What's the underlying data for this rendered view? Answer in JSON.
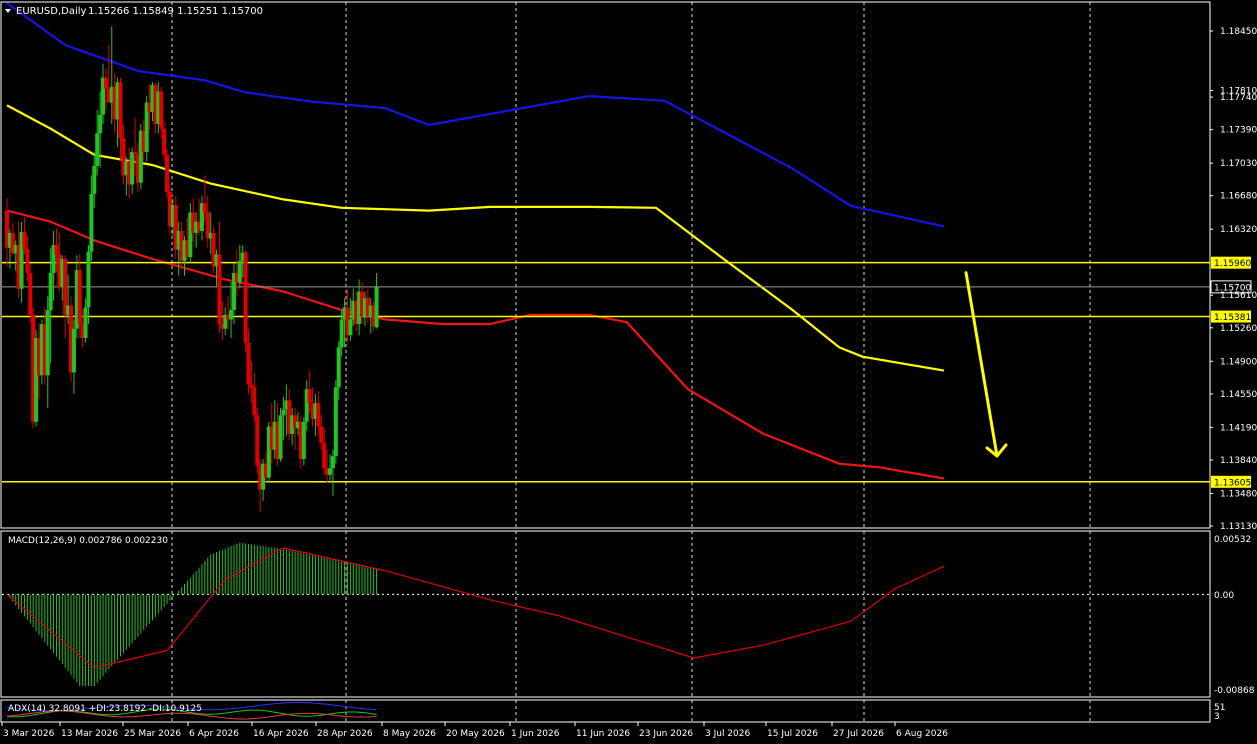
{
  "header": {
    "symbol": "EURUSD,Daily",
    "ohlc": "1.15266 1.15849 1.15251 1.15700"
  },
  "macd_panel": {
    "label": "MACD(12,26,9) 0.002786 0.002230",
    "tick_labels": [
      "0.00532",
      "0.00",
      "-0.00868"
    ]
  },
  "adx_panel": {
    "label": "ADX(14) 32.8091 +DI:23.8192 -DI:10.9125",
    "tick_labels": [
      "51",
      "3"
    ]
  },
  "colors": {
    "bull": "#22c322",
    "bear": "#e00000",
    "ma_blue": "#1414e6",
    "ma_yellow": "#ffff00",
    "ma_red": "#f01414",
    "level": "#ffff00",
    "current_price": "#ffffff",
    "grid": "#ffffff",
    "macd_hist": "#22c322",
    "macd_signal": "#e00000"
  },
  "chart_data": {
    "type": "candlestick",
    "x_tick_labels": [
      "3 Mar 2026",
      "13 Mar 2026",
      "25 Mar 2026",
      "6 Apr 2026",
      "16 Apr 2026",
      "28 Apr 2026",
      "8 May 2026",
      "20 May 2026",
      "1 Jun 2026",
      "11 Jun 2026",
      "23 Jun 2026",
      "3 Jul 2026",
      "15 Jul 2026",
      "27 Jul 2026",
      "6 Aug 2026"
    ],
    "y_tick_labels": [
      1.1845,
      1.1781,
      1.1774,
      1.1739,
      1.1703,
      1.1668,
      1.1632,
      1.1561,
      1.1526,
      1.149,
      1.1455,
      1.1419,
      1.1384,
      1.1348,
      1.1313
    ],
    "ylim": [
      1.1313,
      1.1865
    ],
    "grid": true,
    "horizontal_levels": [
      1.1596,
      1.15381,
      1.13605
    ],
    "current_price": 1.157,
    "last_candle": {
      "open": 1.15266,
      "high": 1.15849,
      "low": 1.15251,
      "close": 1.157
    },
    "annotation": "yellow arrow pointing down from 1.1596 toward 1.1384",
    "candles": [
      {
        "o": 1.1652,
        "h": 1.1665,
        "l": 1.1592,
        "c": 1.1612
      },
      {
        "o": 1.1612,
        "h": 1.1632,
        "l": 1.159,
        "c": 1.1628
      },
      {
        "o": 1.1628,
        "h": 1.1639,
        "l": 1.1604,
        "c": 1.1606
      },
      {
        "o": 1.1606,
        "h": 1.162,
        "l": 1.1587,
        "c": 1.1615
      },
      {
        "o": 1.1615,
        "h": 1.164,
        "l": 1.1558,
        "c": 1.1568
      },
      {
        "o": 1.1568,
        "h": 1.164,
        "l": 1.1553,
        "c": 1.1629
      },
      {
        "o": 1.1629,
        "h": 1.1645,
        "l": 1.1605,
        "c": 1.1611
      },
      {
        "o": 1.1611,
        "h": 1.1625,
        "l": 1.1576,
        "c": 1.1585
      },
      {
        "o": 1.1585,
        "h": 1.1595,
        "l": 1.1531,
        "c": 1.154
      },
      {
        "o": 1.154,
        "h": 1.1548,
        "l": 1.1418,
        "c": 1.1425
      },
      {
        "o": 1.1425,
        "h": 1.1524,
        "l": 1.142,
        "c": 1.1515
      },
      {
        "o": 1.1515,
        "h": 1.1531,
        "l": 1.145,
        "c": 1.1475
      },
      {
        "o": 1.1475,
        "h": 1.1535,
        "l": 1.1465,
        "c": 1.153
      },
      {
        "o": 1.153,
        "h": 1.1548,
        "l": 1.1465,
        "c": 1.1475
      },
      {
        "o": 1.1475,
        "h": 1.156,
        "l": 1.144,
        "c": 1.1545
      },
      {
        "o": 1.1545,
        "h": 1.1612,
        "l": 1.1488,
        "c": 1.1585
      },
      {
        "o": 1.1585,
        "h": 1.163,
        "l": 1.1555,
        "c": 1.1615
      },
      {
        "o": 1.1615,
        "h": 1.1633,
        "l": 1.1585,
        "c": 1.1605
      },
      {
        "o": 1.1605,
        "h": 1.1628,
        "l": 1.1565,
        "c": 1.157
      },
      {
        "o": 1.157,
        "h": 1.1604,
        "l": 1.1555,
        "c": 1.16
      },
      {
        "o": 1.16,
        "h": 1.1604,
        "l": 1.1515,
        "c": 1.154
      },
      {
        "o": 1.154,
        "h": 1.1583,
        "l": 1.153,
        "c": 1.155
      },
      {
        "o": 1.155,
        "h": 1.156,
        "l": 1.1468,
        "c": 1.1478
      },
      {
        "o": 1.1478,
        "h": 1.1535,
        "l": 1.1455,
        "c": 1.1525
      },
      {
        "o": 1.1525,
        "h": 1.1604,
        "l": 1.1515,
        "c": 1.1588
      },
      {
        "o": 1.1588,
        "h": 1.1605,
        "l": 1.1515,
        "c": 1.153
      },
      {
        "o": 1.153,
        "h": 1.1545,
        "l": 1.1505,
        "c": 1.1515
      },
      {
        "o": 1.1515,
        "h": 1.1558,
        "l": 1.151,
        "c": 1.1548
      },
      {
        "o": 1.1548,
        "h": 1.1615,
        "l": 1.153,
        "c": 1.1608
      },
      {
        "o": 1.1608,
        "h": 1.169,
        "l": 1.1598,
        "c": 1.167
      },
      {
        "o": 1.167,
        "h": 1.1715,
        "l": 1.1655,
        "c": 1.17
      },
      {
        "o": 1.17,
        "h": 1.176,
        "l": 1.169,
        "c": 1.1735
      },
      {
        "o": 1.1735,
        "h": 1.178,
        "l": 1.1698,
        "c": 1.1755
      },
      {
        "o": 1.1755,
        "h": 1.181,
        "l": 1.1745,
        "c": 1.1795
      },
      {
        "o": 1.1795,
        "h": 1.1805,
        "l": 1.176,
        "c": 1.1783
      },
      {
        "o": 1.1783,
        "h": 1.183,
        "l": 1.177,
        "c": 1.1768
      },
      {
        "o": 1.1768,
        "h": 1.185,
        "l": 1.1745,
        "c": 1.1785
      },
      {
        "o": 1.1785,
        "h": 1.18,
        "l": 1.1735,
        "c": 1.175
      },
      {
        "o": 1.175,
        "h": 1.1795,
        "l": 1.172,
        "c": 1.179
      },
      {
        "o": 1.179,
        "h": 1.1795,
        "l": 1.1705,
        "c": 1.173
      },
      {
        "o": 1.173,
        "h": 1.1745,
        "l": 1.168,
        "c": 1.169
      },
      {
        "o": 1.169,
        "h": 1.171,
        "l": 1.1668,
        "c": 1.1705
      },
      {
        "o": 1.1705,
        "h": 1.172,
        "l": 1.1665,
        "c": 1.168
      },
      {
        "o": 1.168,
        "h": 1.172,
        "l": 1.167,
        "c": 1.1715
      },
      {
        "o": 1.1715,
        "h": 1.1752,
        "l": 1.169,
        "c": 1.1712
      },
      {
        "o": 1.1712,
        "h": 1.1725,
        "l": 1.1672,
        "c": 1.1682
      },
      {
        "o": 1.1682,
        "h": 1.1745,
        "l": 1.1675,
        "c": 1.1738
      },
      {
        "o": 1.1738,
        "h": 1.175,
        "l": 1.1705,
        "c": 1.1715
      },
      {
        "o": 1.1715,
        "h": 1.1775,
        "l": 1.1705,
        "c": 1.1768
      },
      {
        "o": 1.1768,
        "h": 1.1788,
        "l": 1.1738,
        "c": 1.1758
      },
      {
        "o": 1.1758,
        "h": 1.179,
        "l": 1.1748,
        "c": 1.1787
      },
      {
        "o": 1.1787,
        "h": 1.1789,
        "l": 1.1735,
        "c": 1.1745
      },
      {
        "o": 1.1745,
        "h": 1.179,
        "l": 1.1735,
        "c": 1.178
      },
      {
        "o": 1.178,
        "h": 1.1785,
        "l": 1.173,
        "c": 1.174
      },
      {
        "o": 1.174,
        "h": 1.1748,
        "l": 1.1705,
        "c": 1.1712
      },
      {
        "o": 1.1712,
        "h": 1.1718,
        "l": 1.1665,
        "c": 1.1672
      },
      {
        "o": 1.1672,
        "h": 1.168,
        "l": 1.1625,
        "c": 1.1635
      },
      {
        "o": 1.1635,
        "h": 1.1665,
        "l": 1.1625,
        "c": 1.1658
      },
      {
        "o": 1.1658,
        "h": 1.1668,
        "l": 1.16,
        "c": 1.161
      },
      {
        "o": 1.161,
        "h": 1.164,
        "l": 1.1582,
        "c": 1.163
      },
      {
        "o": 1.163,
        "h": 1.164,
        "l": 1.1592,
        "c": 1.1598
      },
      {
        "o": 1.1598,
        "h": 1.1625,
        "l": 1.1582,
        "c": 1.162
      },
      {
        "o": 1.162,
        "h": 1.1645,
        "l": 1.16,
        "c": 1.1602
      },
      {
        "o": 1.1602,
        "h": 1.166,
        "l": 1.1595,
        "c": 1.165
      },
      {
        "o": 1.165,
        "h": 1.1665,
        "l": 1.1618,
        "c": 1.1628
      },
      {
        "o": 1.1628,
        "h": 1.165,
        "l": 1.1612,
        "c": 1.164
      },
      {
        "o": 1.164,
        "h": 1.1665,
        "l": 1.1625,
        "c": 1.163
      },
      {
        "o": 1.163,
        "h": 1.1668,
        "l": 1.162,
        "c": 1.166
      },
      {
        "o": 1.166,
        "h": 1.169,
        "l": 1.164,
        "c": 1.165
      },
      {
        "o": 1.165,
        "h": 1.1668,
        "l": 1.1612,
        "c": 1.1622
      },
      {
        "o": 1.1622,
        "h": 1.165,
        "l": 1.1605,
        "c": 1.1628
      },
      {
        "o": 1.1628,
        "h": 1.1635,
        "l": 1.1585,
        "c": 1.1592
      },
      {
        "o": 1.1592,
        "h": 1.161,
        "l": 1.157,
        "c": 1.1605
      },
      {
        "o": 1.1605,
        "h": 1.164,
        "l": 1.152,
        "c": 1.153
      },
      {
        "o": 1.153,
        "h": 1.1555,
        "l": 1.1512,
        "c": 1.1525
      },
      {
        "o": 1.1525,
        "h": 1.1548,
        "l": 1.1518,
        "c": 1.154
      },
      {
        "o": 1.154,
        "h": 1.156,
        "l": 1.1525,
        "c": 1.1535
      },
      {
        "o": 1.1535,
        "h": 1.1575,
        "l": 1.1515,
        "c": 1.1545
      },
      {
        "o": 1.1545,
        "h": 1.1595,
        "l": 1.153,
        "c": 1.1585
      },
      {
        "o": 1.1585,
        "h": 1.161,
        "l": 1.156,
        "c": 1.1575
      },
      {
        "o": 1.1575,
        "h": 1.1615,
        "l": 1.1568,
        "c": 1.1598
      },
      {
        "o": 1.1598,
        "h": 1.1615,
        "l": 1.158,
        "c": 1.1607
      },
      {
        "o": 1.1607,
        "h": 1.161,
        "l": 1.15,
        "c": 1.151
      },
      {
        "o": 1.151,
        "h": 1.1525,
        "l": 1.1455,
        "c": 1.1465
      },
      {
        "o": 1.1465,
        "h": 1.149,
        "l": 1.1445,
        "c": 1.1462
      },
      {
        "o": 1.1462,
        "h": 1.1478,
        "l": 1.1425,
        "c": 1.1432
      },
      {
        "o": 1.1432,
        "h": 1.144,
        "l": 1.137,
        "c": 1.1378
      },
      {
        "o": 1.1378,
        "h": 1.1385,
        "l": 1.1328,
        "c": 1.1352
      },
      {
        "o": 1.1352,
        "h": 1.1385,
        "l": 1.134,
        "c": 1.138
      },
      {
        "o": 1.138,
        "h": 1.1392,
        "l": 1.136,
        "c": 1.1365
      },
      {
        "o": 1.1365,
        "h": 1.1425,
        "l": 1.136,
        "c": 1.142
      },
      {
        "o": 1.142,
        "h": 1.1445,
        "l": 1.138,
        "c": 1.1395
      },
      {
        "o": 1.1395,
        "h": 1.1448,
        "l": 1.1385,
        "c": 1.1425
      },
      {
        "o": 1.1425,
        "h": 1.1445,
        "l": 1.1378,
        "c": 1.1385
      },
      {
        "o": 1.1385,
        "h": 1.144,
        "l": 1.1382,
        "c": 1.1432
      },
      {
        "o": 1.1432,
        "h": 1.1452,
        "l": 1.1405,
        "c": 1.1438
      },
      {
        "o": 1.1438,
        "h": 1.1465,
        "l": 1.141,
        "c": 1.1448
      },
      {
        "o": 1.1448,
        "h": 1.146,
        "l": 1.1405,
        "c": 1.1412
      },
      {
        "o": 1.1412,
        "h": 1.144,
        "l": 1.14,
        "c": 1.1432
      },
      {
        "o": 1.1432,
        "h": 1.144,
        "l": 1.1395,
        "c": 1.1418
      },
      {
        "o": 1.1418,
        "h": 1.1435,
        "l": 1.141,
        "c": 1.1425
      },
      {
        "o": 1.1425,
        "h": 1.1432,
        "l": 1.1375,
        "c": 1.1385
      },
      {
        "o": 1.1385,
        "h": 1.143,
        "l": 1.1378,
        "c": 1.1425
      },
      {
        "o": 1.1425,
        "h": 1.147,
        "l": 1.1415,
        "c": 1.146
      },
      {
        "o": 1.146,
        "h": 1.148,
        "l": 1.1435,
        "c": 1.1445
      },
      {
        "o": 1.1445,
        "h": 1.1462,
        "l": 1.142,
        "c": 1.1428
      },
      {
        "o": 1.1428,
        "h": 1.1455,
        "l": 1.141,
        "c": 1.1445
      },
      {
        "o": 1.1445,
        "h": 1.1458,
        "l": 1.141,
        "c": 1.142
      },
      {
        "o": 1.142,
        "h": 1.1432,
        "l": 1.1395,
        "c": 1.1402
      },
      {
        "o": 1.1402,
        "h": 1.1418,
        "l": 1.1368,
        "c": 1.1375
      },
      {
        "o": 1.1375,
        "h": 1.1395,
        "l": 1.136,
        "c": 1.1368
      },
      {
        "o": 1.1368,
        "h": 1.139,
        "l": 1.1362,
        "c": 1.1375
      },
      {
        "o": 1.1375,
        "h": 1.1395,
        "l": 1.1345,
        "c": 1.1388
      },
      {
        "o": 1.1388,
        "h": 1.147,
        "l": 1.138,
        "c": 1.1462
      },
      {
        "o": 1.1462,
        "h": 1.1512,
        "l": 1.1448,
        "c": 1.1505
      },
      {
        "o": 1.1505,
        "h": 1.1545,
        "l": 1.1495,
        "c": 1.1535
      },
      {
        "o": 1.1535,
        "h": 1.1558,
        "l": 1.1505,
        "c": 1.1548
      },
      {
        "o": 1.1548,
        "h": 1.1568,
        "l": 1.151,
        "c": 1.1518
      },
      {
        "o": 1.1518,
        "h": 1.1558,
        "l": 1.1512,
        "c": 1.1535
      },
      {
        "o": 1.1535,
        "h": 1.1568,
        "l": 1.1528,
        "c": 1.1555
      },
      {
        "o": 1.1555,
        "h": 1.1565,
        "l": 1.1522,
        "c": 1.153
      },
      {
        "o": 1.153,
        "h": 1.1578,
        "l": 1.1518,
        "c": 1.1565
      },
      {
        "o": 1.1565,
        "h": 1.1575,
        "l": 1.153,
        "c": 1.1538
      },
      {
        "o": 1.1538,
        "h": 1.1565,
        "l": 1.1528,
        "c": 1.1558
      },
      {
        "o": 1.1558,
        "h": 1.1568,
        "l": 1.1532,
        "c": 1.1538
      },
      {
        "o": 1.1538,
        "h": 1.1558,
        "l": 1.152,
        "c": 1.155
      },
      {
        "o": 1.155,
        "h": 1.1555,
        "l": 1.1522,
        "c": 1.1528
      },
      {
        "o": 1.15266,
        "h": 1.15849,
        "l": 1.15251,
        "c": 1.157
      }
    ],
    "series": [
      {
        "type": "line",
        "color": "blue",
        "values": [
          [
            0,
            1.1875
          ],
          [
            20,
            1.183
          ],
          [
            45,
            1.1802
          ],
          [
            68,
            1.1792
          ],
          [
            82,
            1.1779
          ],
          [
            105,
            1.1769
          ],
          [
            130,
            1.1762
          ],
          [
            145,
            1.1744
          ],
          [
            200,
            1.1775
          ],
          [
            226,
            1.177
          ],
          [
            270,
            1.1697
          ],
          [
            290,
            1.1657
          ],
          [
            322,
            1.1635
          ]
        ]
      },
      {
        "type": "line",
        "color": "yellow",
        "values": [
          [
            0,
            1.1765
          ],
          [
            15,
            1.174
          ],
          [
            30,
            1.1712
          ],
          [
            50,
            1.1701
          ],
          [
            70,
            1.1681
          ],
          [
            95,
            1.1664
          ],
          [
            115,
            1.1655
          ],
          [
            145,
            1.1652
          ],
          [
            166,
            1.1656
          ],
          [
            200,
            1.1656
          ],
          [
            223,
            1.1655
          ],
          [
            245,
            1.1603
          ],
          [
            270,
            1.1545
          ],
          [
            286,
            1.1505
          ],
          [
            294,
            1.1495
          ],
          [
            322,
            1.148
          ]
        ]
      },
      {
        "type": "line",
        "color": "red",
        "values": [
          [
            0,
            1.1652
          ],
          [
            15,
            1.164
          ],
          [
            30,
            1.162
          ],
          [
            50,
            1.16
          ],
          [
            75,
            1.1578
          ],
          [
            95,
            1.1565
          ],
          [
            115,
            1.1545
          ],
          [
            130,
            1.1535
          ],
          [
            150,
            1.153
          ],
          [
            166,
            1.153
          ],
          [
            180,
            1.154
          ],
          [
            200,
            1.154
          ],
          [
            213,
            1.1532
          ],
          [
            234,
            1.146
          ],
          [
            260,
            1.1412
          ],
          [
            286,
            1.138
          ],
          [
            300,
            1.1376
          ],
          [
            322,
            1.1364
          ]
        ]
      }
    ],
    "macd": {
      "histogram_ylim": [
        -0.00868,
        0.00532
      ],
      "hist_points": [
        [
          0,
          0.0
        ],
        [
          25,
          -0.0085
        ],
        [
          30,
          -0.0085
        ],
        [
          70,
          0.0037
        ],
        [
          80,
          0.0048
        ],
        [
          95,
          0.0042
        ],
        [
          130,
          0.0022
        ],
        [
          145,
          0.0012
        ],
        [
          166,
          0.0
        ],
        [
          205,
          -0.003
        ],
        [
          225,
          -0.006
        ],
        [
          232,
          -0.0065
        ],
        [
          245,
          -0.0055
        ],
        [
          265,
          -0.003
        ],
        [
          290,
          0.0
        ],
        [
          300,
          0.0011
        ],
        [
          322,
          0.0026
        ]
      ],
      "signal_points": [
        [
          0,
          0.0
        ],
        [
          30,
          -0.0068
        ],
        [
          55,
          -0.0052
        ],
        [
          75,
          0.0014
        ],
        [
          95,
          0.0043
        ],
        [
          130,
          0.0022
        ],
        [
          166,
          -0.0005
        ],
        [
          190,
          -0.002
        ],
        [
          236,
          -0.0059
        ],
        [
          260,
          -0.0047
        ],
        [
          290,
          -0.0025
        ],
        [
          305,
          0.0005
        ],
        [
          322,
          0.0026
        ]
      ]
    },
    "adx": {
      "ylim": [
        3,
        51
      ]
    }
  }
}
